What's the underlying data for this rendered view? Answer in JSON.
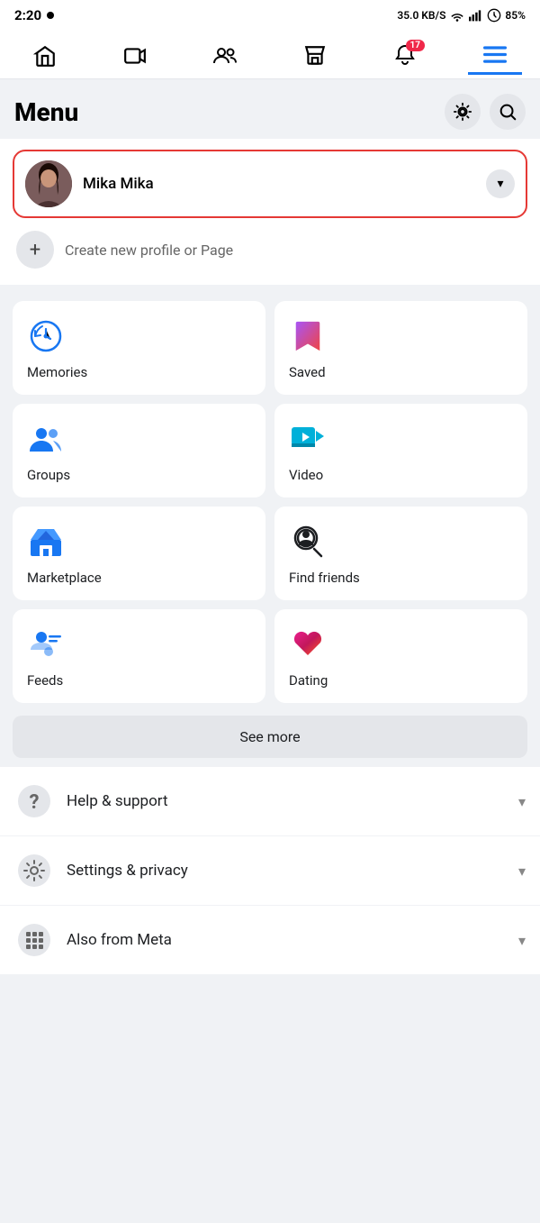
{
  "statusBar": {
    "time": "2:20",
    "battery": "85%",
    "signal": "35.0 KB/S"
  },
  "navBar": {
    "items": [
      {
        "name": "home",
        "label": "Home"
      },
      {
        "name": "video",
        "label": "Video"
      },
      {
        "name": "friends",
        "label": "Friends"
      },
      {
        "name": "store",
        "label": "Store"
      },
      {
        "name": "notifications",
        "label": "Notifications",
        "badge": "17"
      },
      {
        "name": "menu",
        "label": "Menu",
        "active": true
      }
    ]
  },
  "header": {
    "title": "Menu",
    "settingsLabel": "Settings",
    "searchLabel": "Search"
  },
  "profile": {
    "name": "Mika Mika",
    "createLabel": "Create new profile or Page",
    "dropdownLabel": "Dropdown"
  },
  "menuGrid": [
    {
      "id": "memories",
      "label": "Memories",
      "icon": "clock-icon"
    },
    {
      "id": "saved",
      "label": "Saved",
      "icon": "bookmark-icon"
    },
    {
      "id": "groups",
      "label": "Groups",
      "icon": "groups-icon"
    },
    {
      "id": "video",
      "label": "Video",
      "icon": "video-icon"
    },
    {
      "id": "marketplace",
      "label": "Marketplace",
      "icon": "marketplace-icon"
    },
    {
      "id": "find-friends",
      "label": "Find friends",
      "icon": "find-friends-icon"
    },
    {
      "id": "feeds",
      "label": "Feeds",
      "icon": "feeds-icon"
    },
    {
      "id": "dating",
      "label": "Dating",
      "icon": "dating-icon"
    }
  ],
  "seeMore": "See more",
  "bottomItems": [
    {
      "id": "help-support",
      "label": "Help & support",
      "icon": "help-icon"
    },
    {
      "id": "settings-privacy",
      "label": "Settings & privacy",
      "icon": "settings-icon"
    },
    {
      "id": "also-from-meta",
      "label": "Also from Meta",
      "icon": "meta-icon"
    }
  ]
}
